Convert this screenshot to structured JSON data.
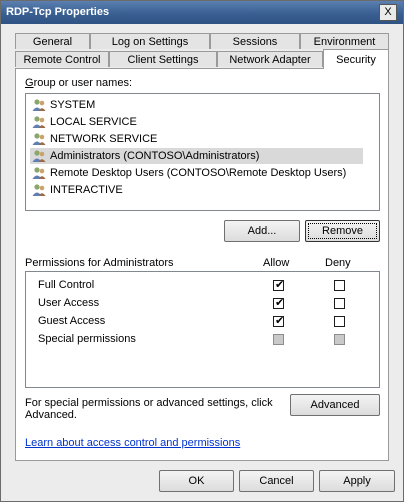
{
  "window": {
    "title": "RDP-Tcp Properties",
    "close_glyph": "X"
  },
  "tabs_back": [
    "General",
    "Log on Settings",
    "Sessions",
    "Environment"
  ],
  "tabs_front": [
    "Remote Control",
    "Client Settings",
    "Network Adapter",
    "Security"
  ],
  "group": {
    "label": "Group or user names:",
    "items": [
      "SYSTEM",
      "LOCAL SERVICE",
      "NETWORK SERVICE",
      "Administrators (CONTOSO\\Administrators)",
      "Remote Desktop Users (CONTOSO\\Remote Desktop Users)",
      "INTERACTIVE"
    ],
    "selected": "Administrators (CONTOSO\\Administrators)"
  },
  "buttons": {
    "add": "Add...",
    "remove": "Remove",
    "advanced": "Advanced",
    "ok": "OK",
    "cancel": "Cancel",
    "apply": "Apply"
  },
  "permissions": {
    "header": "Permissions for Administrators",
    "allow": "Allow",
    "deny": "Deny",
    "rows": [
      {
        "name": "Full Control",
        "allow": true,
        "deny": false
      },
      {
        "name": "User Access",
        "allow": true,
        "deny": false
      },
      {
        "name": "Guest Access",
        "allow": true,
        "deny": false
      },
      {
        "name": "Special permissions",
        "allow": false,
        "deny": false
      }
    ]
  },
  "advanced_text_1": "For special permissions or advanced settings, click",
  "advanced_text_2": "Advanced.",
  "learn_link": "Learn about access control and permissions",
  "check_glyph": "✔"
}
